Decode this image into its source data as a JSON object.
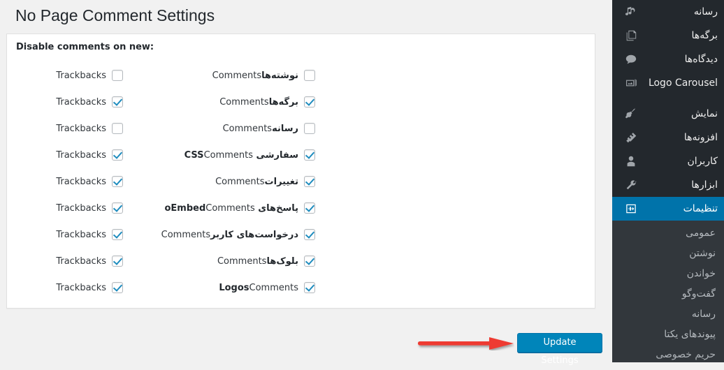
{
  "page": {
    "title": "No Page Comment Settings",
    "disable_label": "Disable comments on new:",
    "comments_label": "Comments",
    "trackbacks_label": "Trackbacks"
  },
  "colors": {
    "accent": "#0085ba",
    "sidebar_bg": "#23282d",
    "submenu_bg": "#32373c",
    "active_menu_bg": "#0073aa",
    "page_bg": "#f1f1f1",
    "panel_bg": "#ffffff",
    "arrow": "#ee3b30",
    "checkbox_check": "#1e8cbe"
  },
  "post_types": [
    {
      "name": "نوشته‌ها",
      "comments": false,
      "trackbacks": false
    },
    {
      "name": "برگه‌ها",
      "comments": true,
      "trackbacks": true
    },
    {
      "name": "رسانه",
      "comments": false,
      "trackbacks": false
    },
    {
      "name": "سفارشی CSS",
      "comments": true,
      "trackbacks": true
    },
    {
      "name": "تغییرات",
      "comments": true,
      "trackbacks": true
    },
    {
      "name": "پاسخ‌های oEmbed",
      "comments": true,
      "trackbacks": true
    },
    {
      "name": "درخواست‌های کاربر",
      "comments": true,
      "trackbacks": true
    },
    {
      "name": "بلوک‌ها",
      "comments": true,
      "trackbacks": true
    },
    {
      "name": "Logos",
      "comments": true,
      "trackbacks": true
    }
  ],
  "submit": {
    "update_label": "Update Settings"
  },
  "sidebar": {
    "items": [
      {
        "label": "رسانه",
        "icon": "media-icon",
        "current": false
      },
      {
        "label": "برگه‌ها",
        "icon": "pages-icon",
        "current": false
      },
      {
        "label": "دیدگاه‌ها",
        "icon": "comments-icon",
        "current": false
      },
      {
        "label": "Logo Carousel",
        "icon": "carousel-icon",
        "current": false
      },
      {
        "label": "نمایش",
        "icon": "appearance-icon",
        "current": false
      },
      {
        "label": "افزونه‌ها",
        "icon": "plugins-icon",
        "current": false
      },
      {
        "label": "کاربران",
        "icon": "users-icon",
        "current": false
      },
      {
        "label": "ابزارها",
        "icon": "tools-icon",
        "current": false
      },
      {
        "label": "تنظیمات",
        "icon": "settings-icon",
        "current": true
      }
    ],
    "submenu": [
      {
        "label": "عمومی"
      },
      {
        "label": "نوشتن"
      },
      {
        "label": "خواندن"
      },
      {
        "label": "گفت‌وگو"
      },
      {
        "label": "رسانه"
      },
      {
        "label": "پیوندهای یکتا"
      },
      {
        "label": "حریم خصوصی"
      }
    ]
  }
}
